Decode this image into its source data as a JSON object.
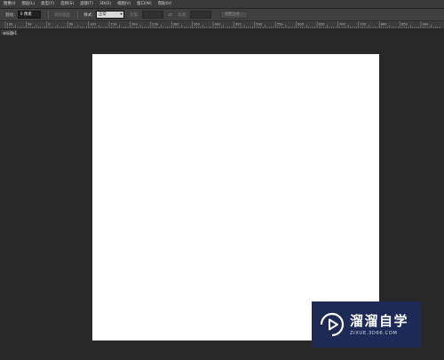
{
  "menubar": {
    "items": [
      "图像(I)",
      "图层(L)",
      "类型(Y)",
      "选择(S)",
      "滤镜(T)",
      "3D(D)",
      "视图(V)",
      "窗口(W)",
      "帮助(H)"
    ]
  },
  "options_bar": {
    "feather_label": "羽化:",
    "feather_value": "0 像素",
    "antialias_label": "消除锯齿",
    "style_label": "样式:",
    "style_value": "正常",
    "width_label": "宽度:",
    "height_label": "高度:",
    "refine_edge_label": "调整边缘..."
  },
  "ruler": {
    "labels": [
      "100",
      "50",
      "0",
      "50",
      "100",
      "150",
      "200",
      "250",
      "300",
      "350",
      "400",
      "450",
      "500",
      "550",
      "600",
      "650",
      "700",
      "750",
      "800",
      "850",
      "900"
    ]
  },
  "document_tab": {
    "label": "未标题-1"
  },
  "watermark": {
    "title": "溜溜自学",
    "url": "ZIXUE.3D66.COM"
  },
  "colors": {
    "workspace": "#282828",
    "canvas": "#ffffff",
    "watermark_bg": "#1c2a55"
  },
  "icons": [
    "link-icon",
    "close-icon",
    "play-logo-icon",
    "chevron-down-icon"
  ]
}
